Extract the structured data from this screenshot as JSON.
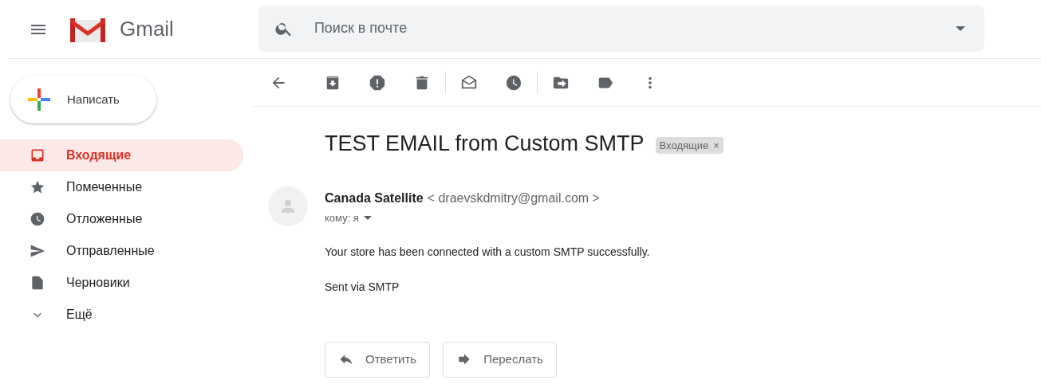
{
  "header": {
    "logo_text": "Gmail",
    "search": {
      "placeholder": "Поиск в почте"
    }
  },
  "sidebar": {
    "compose": "Написать",
    "items": [
      {
        "label": "Входящие",
        "selected": true
      },
      {
        "label": "Помеченные",
        "selected": false
      },
      {
        "label": "Отложенные",
        "selected": false
      },
      {
        "label": "Отправленные",
        "selected": false
      },
      {
        "label": "Черновики",
        "selected": false
      },
      {
        "label": "Ещё",
        "selected": false
      }
    ]
  },
  "message": {
    "subject": "TEST EMAIL from Custom SMTP",
    "label": {
      "text": "Входящие",
      "remove": "×"
    },
    "sender": {
      "name": "Canada Satellite",
      "email": "< draevskdmitry@gmail.com >"
    },
    "to": "кому: я",
    "body": [
      "Your store has been connected with a custom SMTP successfully.",
      "Sent via SMTP"
    ],
    "actions": [
      "Ответить",
      "Переслать"
    ]
  }
}
